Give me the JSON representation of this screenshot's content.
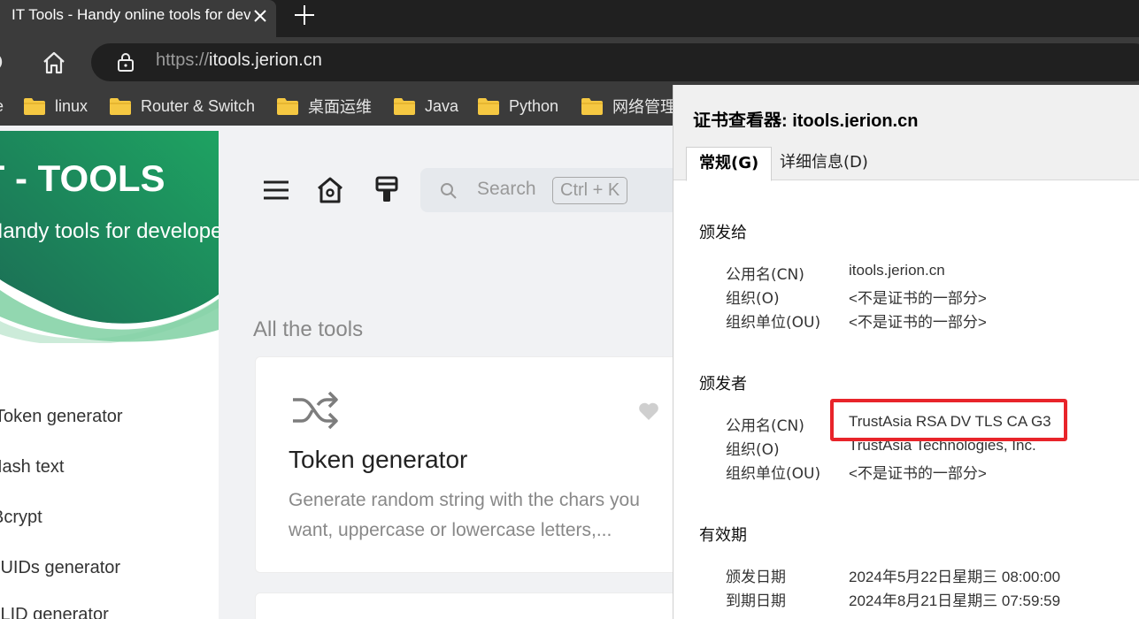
{
  "browser": {
    "tab_title": "IT Tools - Handy online tools for developers",
    "url_scheme": "https://",
    "url_host": "itools.jerion.cn",
    "bookmarks": [
      {
        "label": "e"
      },
      {
        "label": "linux"
      },
      {
        "label": "Router & Switch"
      },
      {
        "label": "桌面运维"
      },
      {
        "label": "Java"
      },
      {
        "label": "Python"
      },
      {
        "label": "网络管理"
      }
    ]
  },
  "page": {
    "brand": "IT - TOOLS",
    "tagline": "Handy tools for developers",
    "nav_items": [
      "Token generator",
      "Hash text",
      "Bcrypt",
      "UUIDs generator",
      "ULID generator"
    ],
    "search": {
      "placeholder": "Search",
      "shortcut": "Ctrl + K"
    },
    "section_title": "All the tools",
    "card": {
      "title": "Token generator",
      "description": "Generate random string with the chars you want, uppercase or lowercase letters,..."
    }
  },
  "cert_viewer": {
    "title": "证书查看器: itools.jerion.cn",
    "tabs": [
      "常规(G)",
      "详细信息(D)"
    ],
    "issued_to": {
      "heading": "颁发给",
      "rows": [
        {
          "label": "公用名(CN)",
          "value": "itools.jerion.cn"
        },
        {
          "label": "组织(O)",
          "value": "<不是证书的一部分>"
        },
        {
          "label": "组织单位(OU)",
          "value": "<不是证书的一部分>"
        }
      ]
    },
    "issued_by": {
      "heading": "颁发者",
      "rows": [
        {
          "label": "公用名(CN)",
          "value": "TrustAsia RSA DV TLS CA G3"
        },
        {
          "label": "组织(O)",
          "value": "TrustAsia Technologies, Inc."
        },
        {
          "label": "组织单位(OU)",
          "value": "<不是证书的一部分>"
        }
      ]
    },
    "validity": {
      "heading": "有效期",
      "rows": [
        {
          "label": "颁发日期",
          "value": "2024年5月22日星期三 08:00:00"
        },
        {
          "label": "到期日期",
          "value": "2024年8月21日星期三 07:59:59"
        }
      ]
    },
    "highlight_color": "#e8242a"
  },
  "colors": {
    "brand_green": "#1ea362",
    "brand_dark_green": "#1b6e55"
  }
}
